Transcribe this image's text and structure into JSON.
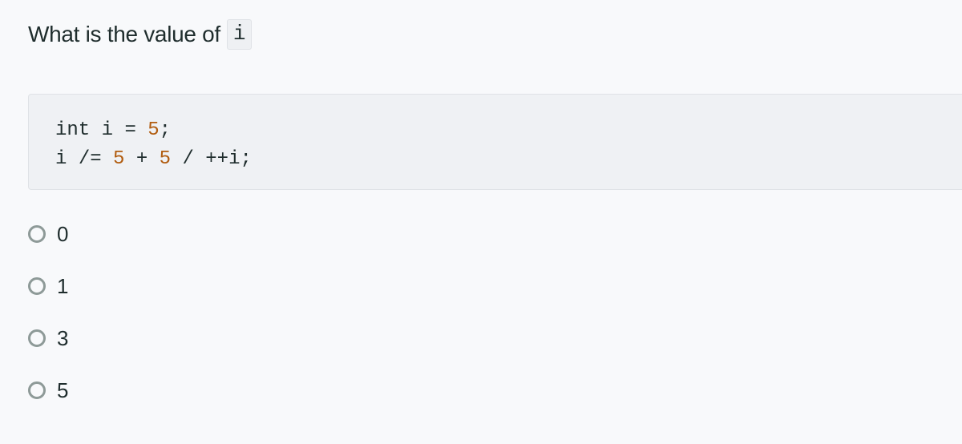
{
  "question": {
    "text": "What is the value of",
    "inline_code": "i"
  },
  "code": {
    "line1": {
      "kw": "int",
      "var": "i",
      "op": "=",
      "num": "5",
      "end": ";"
    },
    "line2": {
      "var": "i",
      "op": "/=",
      "num1": "5",
      "plus": "+",
      "num2": "5",
      "div": "/",
      "rest": "++i;"
    }
  },
  "options": [
    {
      "label": "0"
    },
    {
      "label": "1"
    },
    {
      "label": "3"
    },
    {
      "label": "5"
    }
  ]
}
